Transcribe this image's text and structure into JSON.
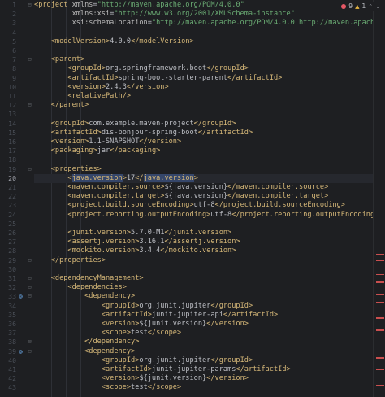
{
  "status": {
    "errors": "9",
    "warnings": "1"
  },
  "editor": {
    "current_line": 20,
    "lines": [
      {
        "n": 1,
        "text": "<project xmlns=\"http://maven.apache.org/POM/4.0.0\"",
        "fold": "⊟"
      },
      {
        "n": 2,
        "text": "         xmlns:xsi=\"http://www.w3.org/2001/XMLSchema-instance\""
      },
      {
        "n": 3,
        "text": "         xsi:schemaLocation=\"http://maven.apache.org/POM/4.0.0 http://maven.apache.org/maven-v4"
      },
      {
        "n": 4,
        "text": ""
      },
      {
        "n": 5,
        "text": "    <modelVersion>4.0.0</modelVersion>"
      },
      {
        "n": 6,
        "text": ""
      },
      {
        "n": 7,
        "text": "    <parent>",
        "fold": "⊟"
      },
      {
        "n": 8,
        "text": "        <groupId>org.springframework.boot</groupId>"
      },
      {
        "n": 9,
        "text": "        <artifactId>spring-boot-starter-parent</artifactId>"
      },
      {
        "n": 10,
        "text": "        <version>2.4.3</version>"
      },
      {
        "n": 11,
        "text": "        <relativePath/>"
      },
      {
        "n": 12,
        "text": "    </parent>",
        "fold": "⊟"
      },
      {
        "n": 13,
        "text": ""
      },
      {
        "n": 14,
        "text": "    <groupId>com.example.maven-project</groupId>"
      },
      {
        "n": 15,
        "text": "    <artifactId>dis-bonjour-spring-boot</artifactId>"
      },
      {
        "n": 16,
        "text": "    <version>1.1-SNAPSHOT</version>"
      },
      {
        "n": 17,
        "text": "    <packaging>jar</packaging>"
      },
      {
        "n": 18,
        "text": ""
      },
      {
        "n": 19,
        "text": "    <properties>",
        "fold": "⊟"
      },
      {
        "n": 20,
        "text": "        <java.version>17</java.version>"
      },
      {
        "n": 21,
        "text": "        <maven.compiler.source>${java.version}</maven.compiler.source>"
      },
      {
        "n": 22,
        "text": "        <maven.compiler.target>${java.version}</maven.compiler.target>"
      },
      {
        "n": 23,
        "text": "        <project.build.sourceEncoding>utf-8</project.build.sourceEncoding>"
      },
      {
        "n": 24,
        "text": "        <project.reporting.outputEncoding>utf-8</project.reporting.outputEncoding>"
      },
      {
        "n": 25,
        "text": ""
      },
      {
        "n": 26,
        "text": "        <junit.version>5.7.0-M1</junit.version>"
      },
      {
        "n": 27,
        "text": "        <assertj.version>3.16.1</assertj.version>"
      },
      {
        "n": 28,
        "text": "        <mockito.version>3.4.4</mockito.version>"
      },
      {
        "n": 29,
        "text": "    </properties>",
        "fold": "⊟"
      },
      {
        "n": 30,
        "text": ""
      },
      {
        "n": 31,
        "text": "    <dependencyManagement>",
        "fold": "⊟"
      },
      {
        "n": 32,
        "text": "        <dependencies>",
        "fold": "⊟"
      },
      {
        "n": 33,
        "text": "            <dependency>",
        "fold": "⊟",
        "icon": "⊚"
      },
      {
        "n": 34,
        "text": "                <groupId>org.junit.jupiter</groupId>"
      },
      {
        "n": 35,
        "text": "                <artifactId>junit-jupiter-api</artifactId>"
      },
      {
        "n": 36,
        "text": "                <version>${junit.version}</version>"
      },
      {
        "n": 37,
        "text": "                <scope>test</scope>"
      },
      {
        "n": 38,
        "text": "            </dependency>",
        "fold": "⊟"
      },
      {
        "n": 39,
        "text": "            <dependency>",
        "fold": "⊟",
        "icon": "⊚"
      },
      {
        "n": 40,
        "text": "                <groupId>org.junit.jupiter</groupId>"
      },
      {
        "n": 41,
        "text": "                <artifactId>junit-jupiter-params</artifactId>"
      },
      {
        "n": 42,
        "text": "                <version>${junit.version}</version>"
      },
      {
        "n": 43,
        "text": "                <scope>test</scope>"
      }
    ]
  },
  "scroll_marks": [
    0.64,
    0.655,
    0.69,
    0.71,
    0.74,
    0.76,
    0.8,
    0.83,
    0.86,
    0.9,
    0.93,
    0.97
  ]
}
